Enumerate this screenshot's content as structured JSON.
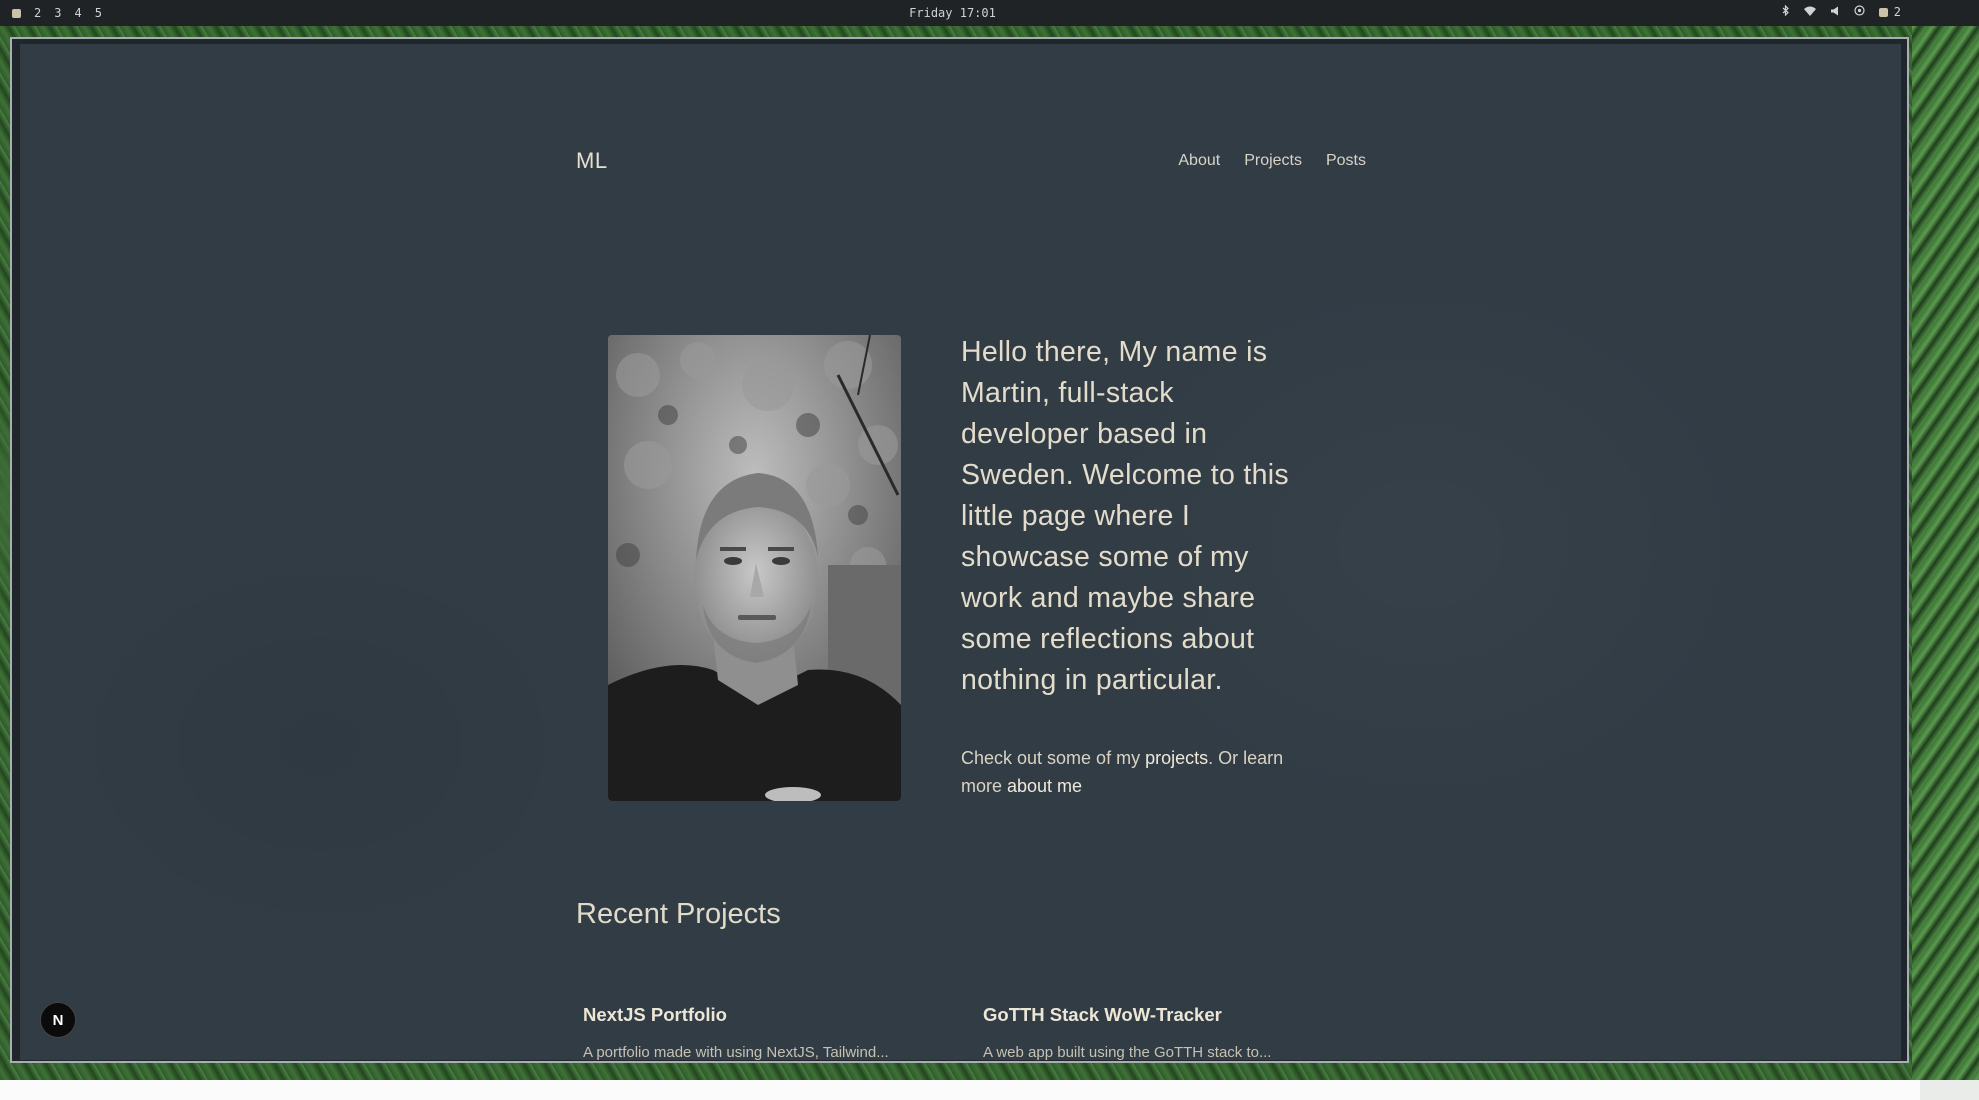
{
  "system_bar": {
    "workspaces": [
      "2",
      "3",
      "4",
      "5"
    ],
    "clock": "Friday 17:01",
    "tray_icons": [
      "bluetooth-icon",
      "wifi-icon",
      "volume-icon",
      "network-icon"
    ],
    "notification_count": "2"
  },
  "site": {
    "logo": "ML",
    "nav": {
      "about": "About",
      "projects": "Projects",
      "posts": "Posts"
    }
  },
  "hero": {
    "intro": "Hello there, My name is Martin, full-stack developer based in Sweden. Welcome to this little page where I showcase some of my work and maybe share some reflections about nothing in particular.",
    "cta_prefix": "Check out some of my ",
    "cta_projects_link": "projects",
    "cta_middle": ". Or learn more ",
    "cta_about_link": "about me"
  },
  "recent_projects": {
    "title": "Recent Projects",
    "items": [
      {
        "title": "NextJS Portfolio",
        "desc": "A portfolio made with using NextJS, Tailwind..."
      },
      {
        "title": "GoTTH Stack WoW-Tracker",
        "desc": "A web app built using the GoTTH stack to..."
      }
    ]
  },
  "dev_badge": "N",
  "colors": {
    "page_background": "#313c45",
    "text": "#e3dccb",
    "wallpaper_green": "#2c4d28"
  }
}
